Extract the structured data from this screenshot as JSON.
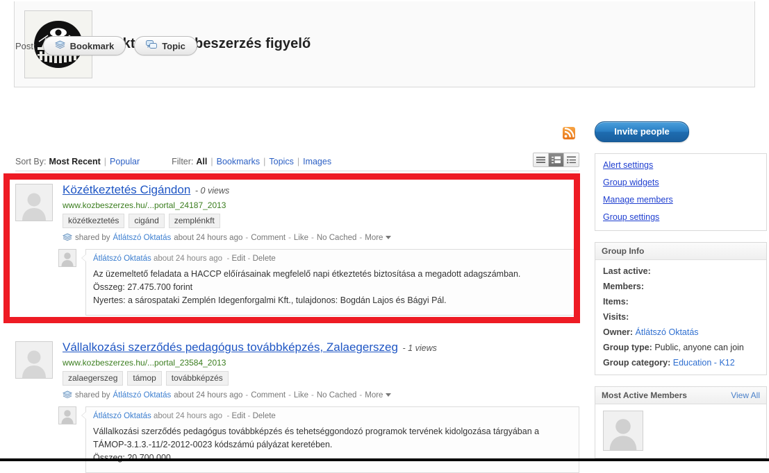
{
  "header": {
    "group_title": "Oktatási közbeszerzés figyelő",
    "logo_icon": "eye-over-parliament-logo"
  },
  "toolbar": {
    "post_label": "Post:",
    "bookmark_button": "Bookmark",
    "bookmark_icon": "bookmark-stack-icon",
    "topic_button": "Topic",
    "topic_icon": "speech-bubbles-icon",
    "rss_icon": "rss-feed-icon"
  },
  "filter_bar": {
    "sort_label": "Sort By:",
    "sort_active": "Most Recent",
    "sort_options": [
      "Most Recent",
      "Popular"
    ],
    "filter_label": "Filter:",
    "filter_active": "All",
    "filter_options": [
      "All",
      "Bookmarks",
      "Topics",
      "Images"
    ],
    "view_modes": [
      "list-compact-view",
      "list-detail-view",
      "list-summary-view"
    ],
    "view_active_index": 1
  },
  "posts": [
    {
      "title": "Közétkeztetés Cigándon",
      "views": "- 0 views",
      "url": "www.kozbeszerzes.hu/...portal_24187_2013",
      "tags": [
        "közétkeztetés",
        "cigánd",
        "zemplénkft"
      ],
      "shared_prefix": "shared by",
      "author": "Átlátszó Oktatás",
      "time": "about 24 hours ago",
      "actions": [
        "Comment",
        "Like",
        "No Cached",
        "More"
      ],
      "share_icon": "bookmark-stack-icon",
      "more_icon": "caret-down-icon",
      "comment": {
        "author": "Átlátszó Oktatás",
        "time": "about 24 hours ago",
        "actions": [
          "Edit",
          "Delete"
        ],
        "lines": [
          "Az üzemeltető feladata a HACCP előírásainak megfelelő napi étkeztetés biztosítása a megadott adagszámban.",
          "Összeg: 27.475.700 forint",
          "Nyertes: a sárospataki Zemplén Idegenforgalmi Kft., tulajdonos: Bogdán Lajos és Bágyi Pál."
        ]
      }
    },
    {
      "title": "Vállalkozási szerződés pedagógus továbbképzés, Zalaegerszeg",
      "views": "- 1 views",
      "url": "www.kozbeszerzes.hu/...portal_23584_2013",
      "tags": [
        "zalaegerszeg",
        "támop",
        "továbbképzés"
      ],
      "shared_prefix": "shared by",
      "author": "Átlátszó Oktatás",
      "time": "about 24 hours ago",
      "actions": [
        "Comment",
        "Like",
        "No Cached",
        "More"
      ],
      "share_icon": "bookmark-stack-icon",
      "more_icon": "caret-down-icon",
      "comment": {
        "author": "Átlátszó Oktatás",
        "time": "about 24 hours ago",
        "actions": [
          "Edit",
          "Delete"
        ],
        "lines": [
          "Vállalkozási szerződés pedagógus továbbképzés és tehetséggondozó programok tervének kidolgozása tárgyában a",
          "TÁMOP-3.1.3.-11/2-2012-0023 kódszámú pályázat keretében.",
          "Összeg: 20.700.000"
        ]
      }
    }
  ],
  "sidebar": {
    "invite_button": "Invite people",
    "admin_links": [
      "Alert settings",
      "Group widgets",
      "Manage members",
      "Group settings"
    ],
    "group_info": {
      "title": "Group Info",
      "rows": [
        {
          "key": "Last active:",
          "value": "",
          "link": false
        },
        {
          "key": "Members:",
          "value": "",
          "link": false
        },
        {
          "key": "Items:",
          "value": "",
          "link": false
        },
        {
          "key": "Visits:",
          "value": "",
          "link": false
        },
        {
          "key": "Owner:",
          "value": "Átlátszó Oktatás",
          "link": true
        },
        {
          "key": "Group type:",
          "value": "Public, anyone can join",
          "link": false
        },
        {
          "key": "Group category:",
          "value": "Education - K12",
          "link": true
        }
      ]
    },
    "most_active": {
      "title": "Most Active Members",
      "view_all": "View All",
      "member_icon": "default-user-avatar"
    }
  },
  "annotation": {
    "highlight_color": "#ee1b24"
  }
}
